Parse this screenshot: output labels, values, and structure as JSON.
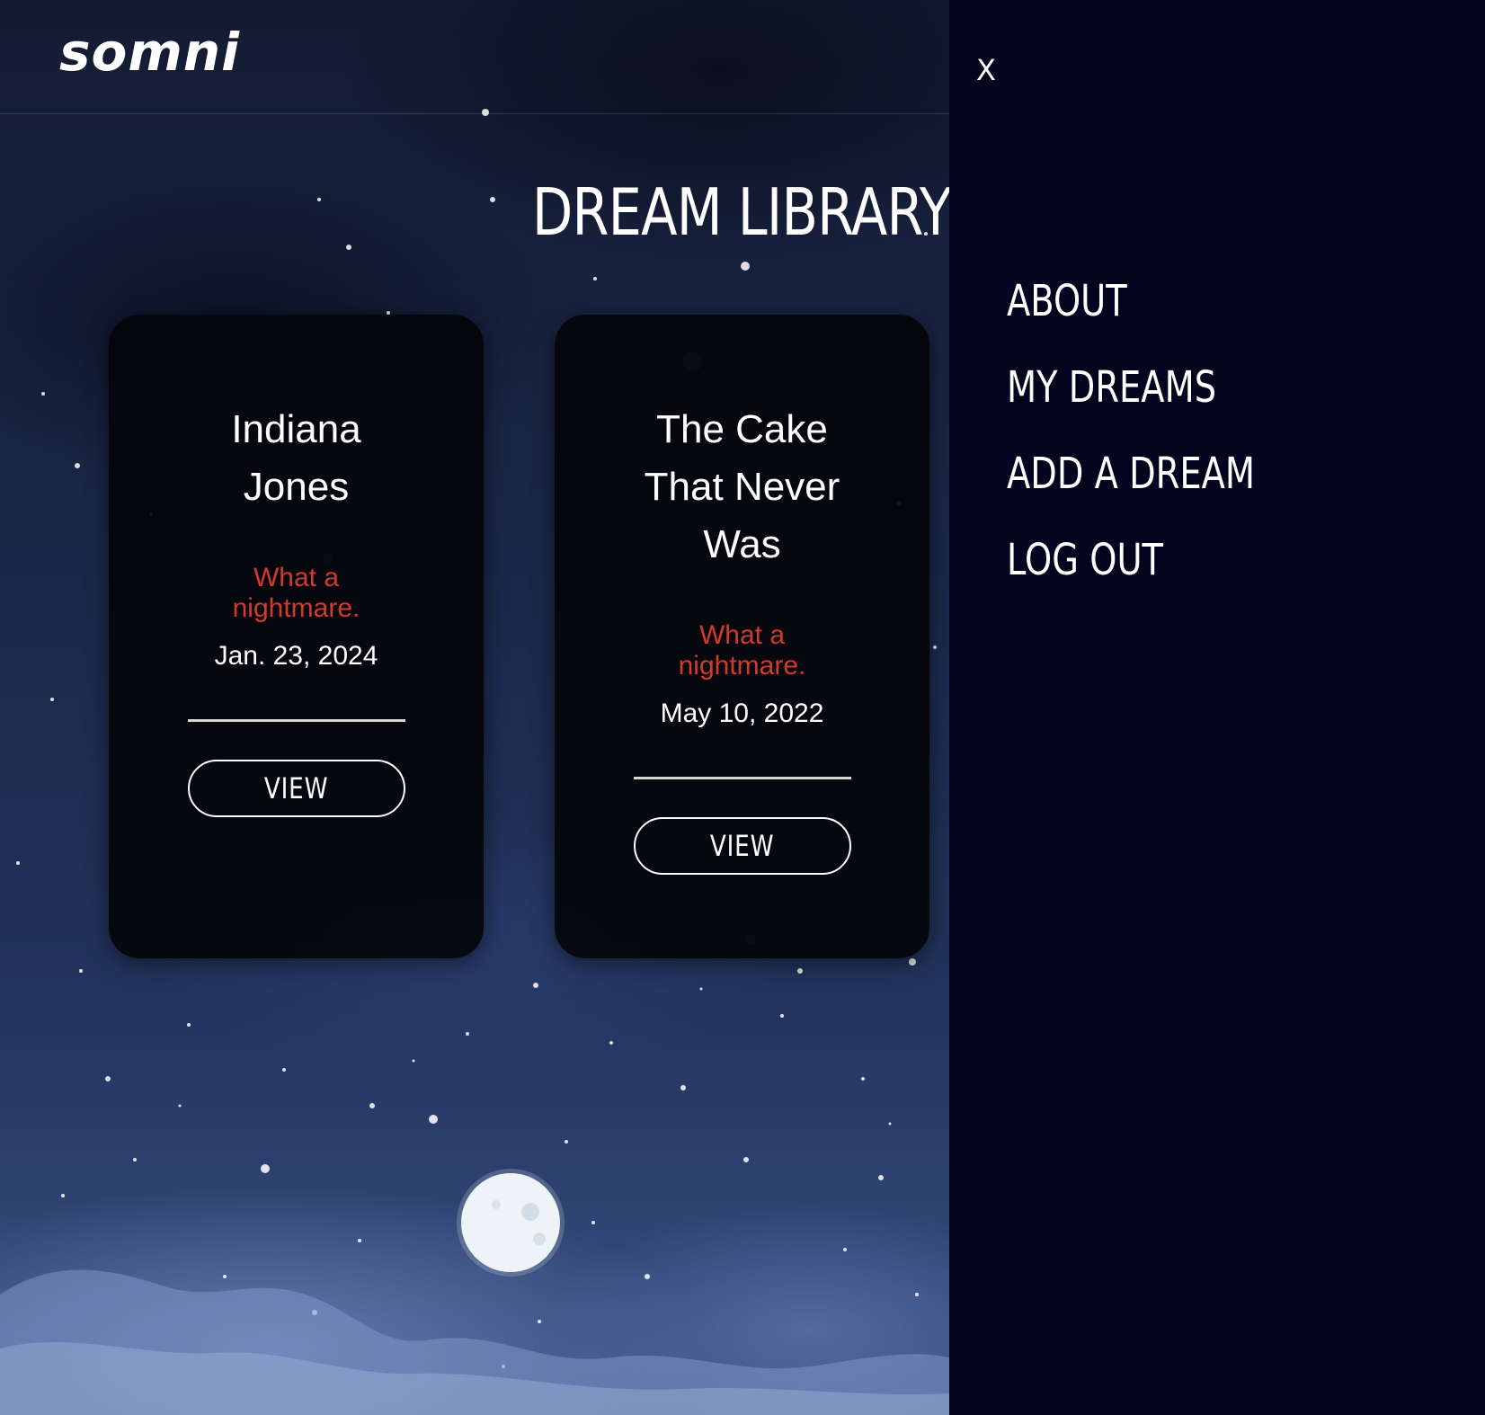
{
  "brand": {
    "logo": "somni"
  },
  "main": {
    "title": "DREAM LIBRARY",
    "cards": [
      {
        "title": "Indiana Jones",
        "mood": "What a nightmare.",
        "date": "Jan. 23, 2024",
        "button_label": "VIEW"
      },
      {
        "title": "The Cake That Never Was",
        "mood": "What a nightmare.",
        "date": "May 10, 2022",
        "button_label": "VIEW"
      }
    ]
  },
  "drawer": {
    "close_label": "X",
    "nav": [
      {
        "label": "ABOUT"
      },
      {
        "label": "MY DREAMS"
      },
      {
        "label": "ADD A DREAM"
      },
      {
        "label": "LOG OUT"
      }
    ]
  },
  "colors": {
    "drawer_bg": "#05041e",
    "card_bg": "#04050a",
    "mood_text": "#d13a2c",
    "text": "#ffffff"
  },
  "icons": {
    "background": "night-sky-with-moon",
    "close": "close-icon"
  }
}
